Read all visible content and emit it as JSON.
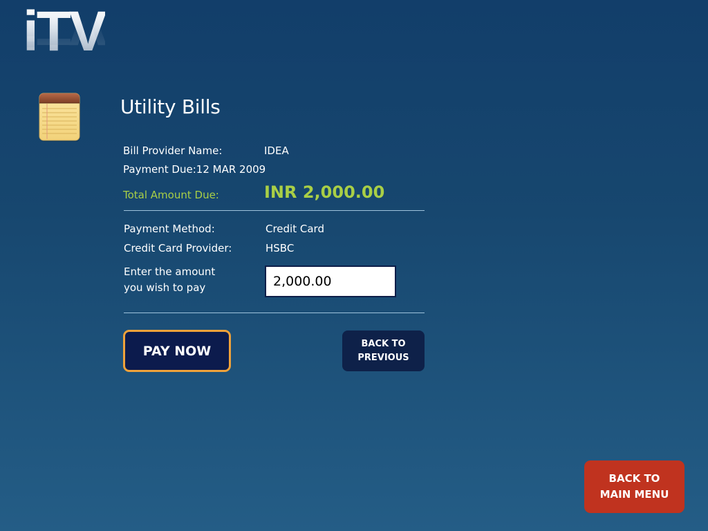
{
  "brand": {
    "logo_text": "iTV"
  },
  "header": {
    "title": "Utility Bills",
    "icon": "notepad-icon"
  },
  "bill": {
    "provider_label": "Bill Provider Name:",
    "provider_value": "IDEA",
    "payment_due": "Payment Due:12 MAR 2009",
    "total_label": "Total Amount Due:",
    "total_value": "INR 2,000.00"
  },
  "payment": {
    "method_label": "Payment Method:",
    "method_value": "Credit Card",
    "cc_provider_label": "Credit Card Provider:",
    "cc_provider_value": "HSBC",
    "amount_label": "Enter the amount\nyou wish to pay",
    "amount_value": "2,000.00"
  },
  "actions": {
    "pay_now": "PAY NOW",
    "back_previous": "BACK TO\nPREVIOUS",
    "back_main_menu": "BACK TO\nMAIN MENU"
  },
  "colors": {
    "background_top": "#123e6a",
    "background_bottom": "#245d86",
    "accent_green": "#a9cf46",
    "pay_button_border": "#f0a23a",
    "pay_button_fill": "#0c1b4d",
    "main_menu_button": "#c0331f"
  }
}
